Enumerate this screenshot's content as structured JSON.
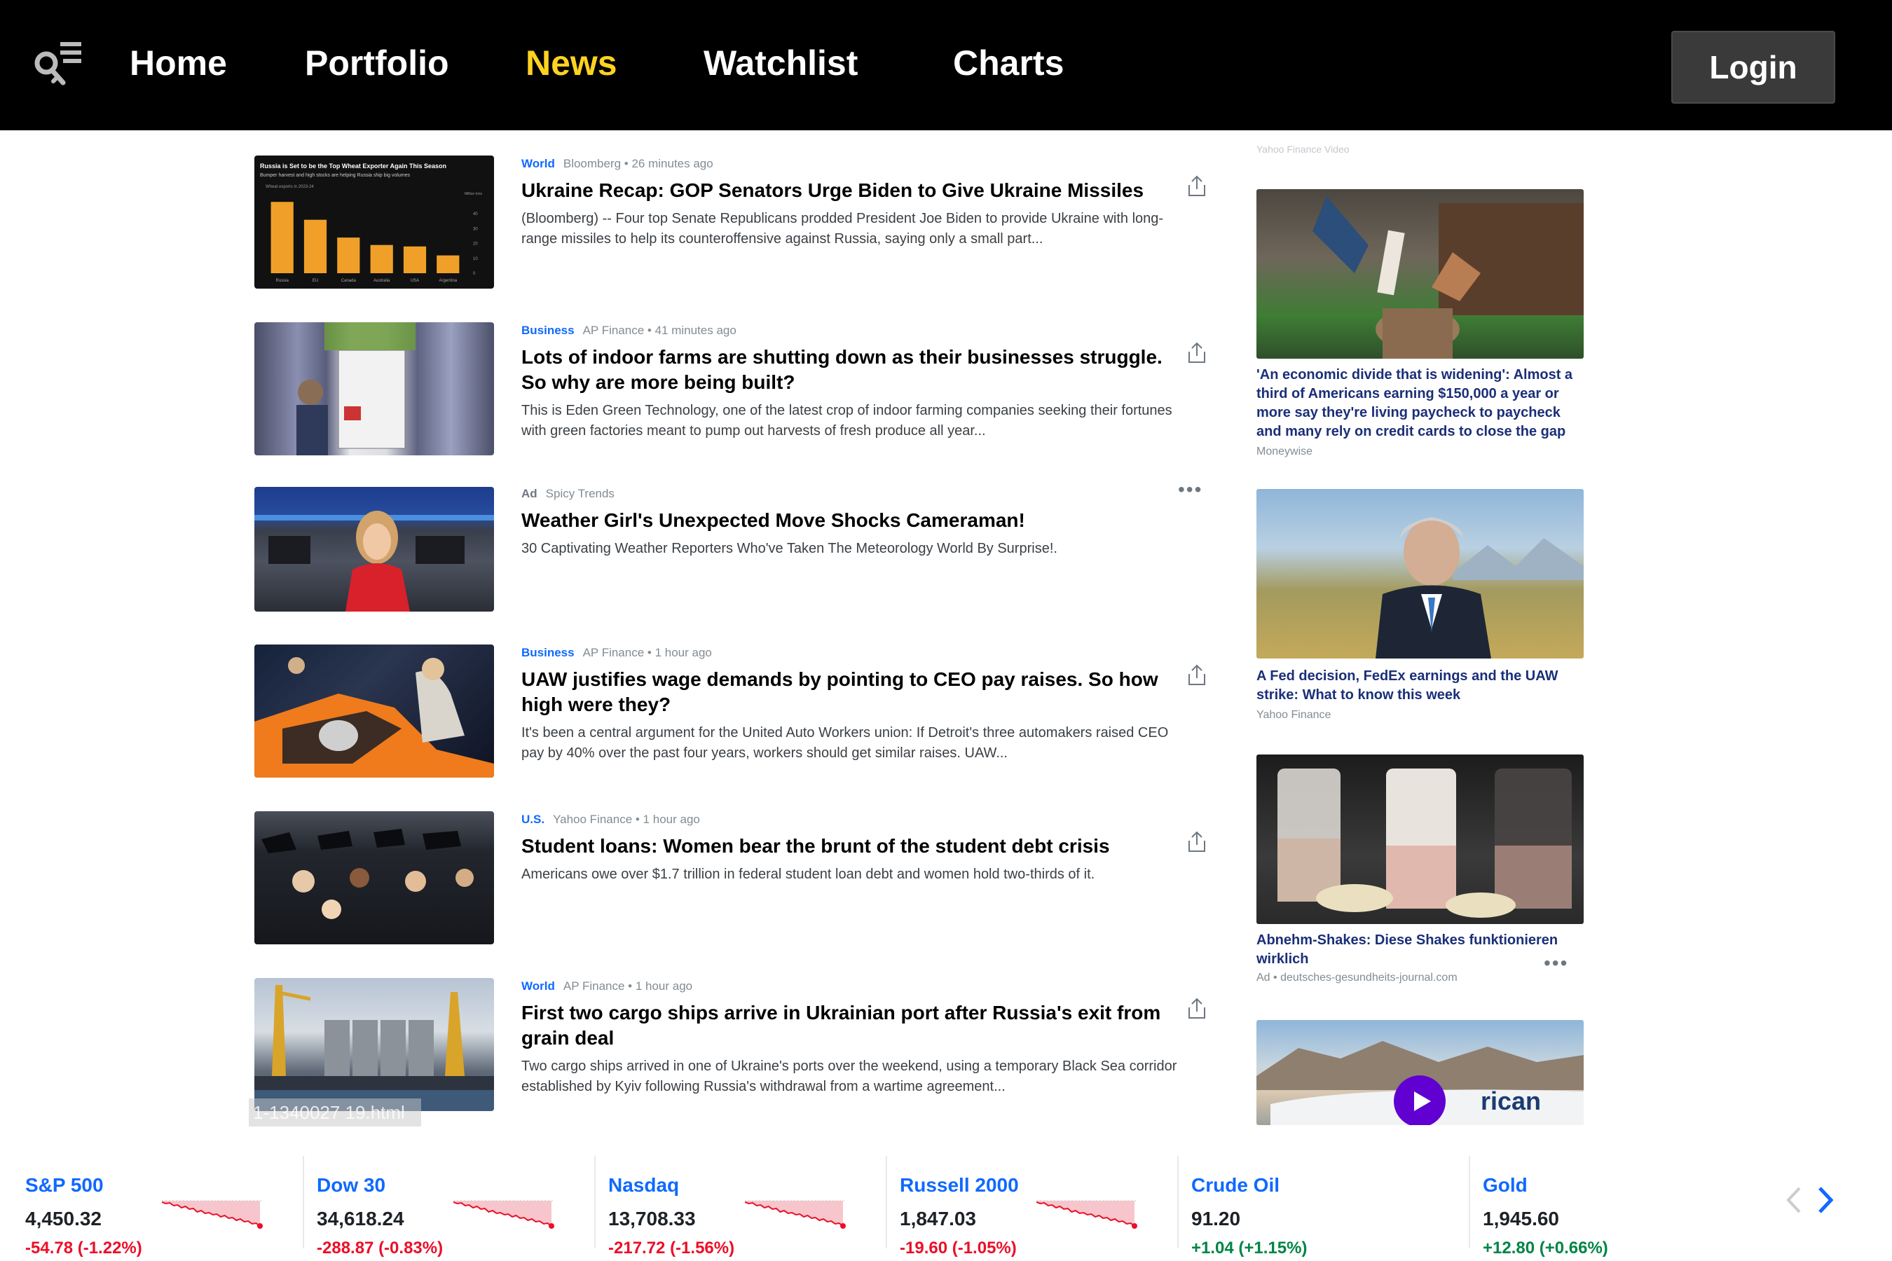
{
  "nav": {
    "items": [
      "Home",
      "Portfolio",
      "News",
      "Watchlist",
      "Charts"
    ],
    "active": "News",
    "login": "Login"
  },
  "articles": [
    {
      "category": "World",
      "source": "Bloomberg • 26 minutes ago",
      "title": "Ukraine Recap: GOP Senators Urge Biden to Give Ukraine Missiles",
      "summary": "(Bloomberg) -- Four top Senate Republicans prodded President Joe Biden to provide Ukraine with long-range missiles to help its counteroffensive against Russia, saying only a small part...",
      "thumb_chart": {
        "title": "Russia is Set to be the Top Wheat Exporter Again This Season",
        "subtitle": "Bumper harvest and high stocks are helping Russia ship big volumes",
        "label": "Wheat exports in 2023-24",
        "unit": "Million tons",
        "categories": [
          "Russia",
          "EU",
          "Canada",
          "Australia",
          "USA",
          "Argentina"
        ],
        "values": [
          48,
          36,
          24,
          19,
          18,
          12
        ],
        "ylim": [
          0,
          50
        ],
        "yticks": [
          "40",
          "30",
          "20",
          "10",
          "0"
        ]
      }
    },
    {
      "category": "Business",
      "source": "AP Finance • 41 minutes ago",
      "title": "Lots of indoor farms are shutting down as their businesses struggle. So why are more being built?",
      "summary": "This is Eden Green Technology, one of the latest crop of indoor farming companies seeking their fortunes with green factories meant to pump out harvests of fresh produce all year..."
    },
    {
      "category": "Ad",
      "source": "Spicy Trends",
      "title": "Weather Girl's Unexpected Move Shocks Cameraman!",
      "summary": "30 Captivating Weather Reporters Who've Taken The Meteorology World By Surprise!."
    },
    {
      "category": "Business",
      "source": "AP Finance • 1 hour ago",
      "title": "UAW justifies wage demands by pointing to CEO pay raises. So how high were they?",
      "summary": "It's been a central argument for the United Auto Workers union: If Detroit's three automakers raised CEO pay by 40% over the past four years, workers should get similar raises. UAW..."
    },
    {
      "category": "U.S.",
      "source": "Yahoo Finance • 1 hour ago",
      "title": "Student loans: Women bear the brunt of the student debt crisis",
      "summary": "Americans owe over $1.7 trillion in federal student loan debt and women hold two-thirds of it."
    },
    {
      "category": "World",
      "source": "AP Finance • 1 hour ago",
      "title": "First two cargo ships arrive in Ukrainian port after Russia's exit from grain deal",
      "summary": "Two cargo ships arrived in one of Ukraine's ports over the weekend, using a temporary Black Sea corridor established by Kyiv following Russia's withdrawal from a wartime agreement..."
    }
  ],
  "sidebar": {
    "top_label": "Yahoo Finance Video",
    "cards": [
      {
        "title": "'An economic divide that is widening': Almost a third of Americans earning $150,000 a year or more say they're living paycheck to paycheck and many rely on credit cards to close the gap",
        "source": "Moneywise"
      },
      {
        "title": "A Fed decision, FedEx earnings and the UAW strike: What to know this week",
        "source": "Yahoo Finance"
      },
      {
        "title": "Abnehm-Shakes: Diese Shakes funktionieren wirklich",
        "source": "Ad • deutsches-gesundheits-journal.com"
      },
      {
        "title": "",
        "source": "",
        "plane_text": "rican"
      }
    ]
  },
  "watermark": "1-1340027 19.html",
  "tickers": [
    {
      "name": "S&P 500",
      "price": "4,450.32",
      "change": "-54.78 (-1.22%)",
      "direction": "neg"
    },
    {
      "name": "Dow 30",
      "price": "34,618.24",
      "change": "-288.87 (-0.83%)",
      "direction": "neg"
    },
    {
      "name": "Nasdaq",
      "price": "13,708.33",
      "change": "-217.72 (-1.56%)",
      "direction": "neg"
    },
    {
      "name": "Russell 2000",
      "price": "1,847.03",
      "change": "-19.60 (-1.05%)",
      "direction": "neg"
    },
    {
      "name": "Crude Oil",
      "price": "91.20",
      "change": "+1.04 (+1.15%)",
      "direction": "pos"
    },
    {
      "name": "Gold",
      "price": "1,945.60",
      "change": "+12.80 (+0.66%)",
      "direction": "pos"
    }
  ],
  "colors": {
    "accent": "#0f69ff",
    "active_nav": "#ffd21f",
    "negative": "#eb0f29",
    "positive": "#008545",
    "sidebar_title": "#1b2f78"
  }
}
